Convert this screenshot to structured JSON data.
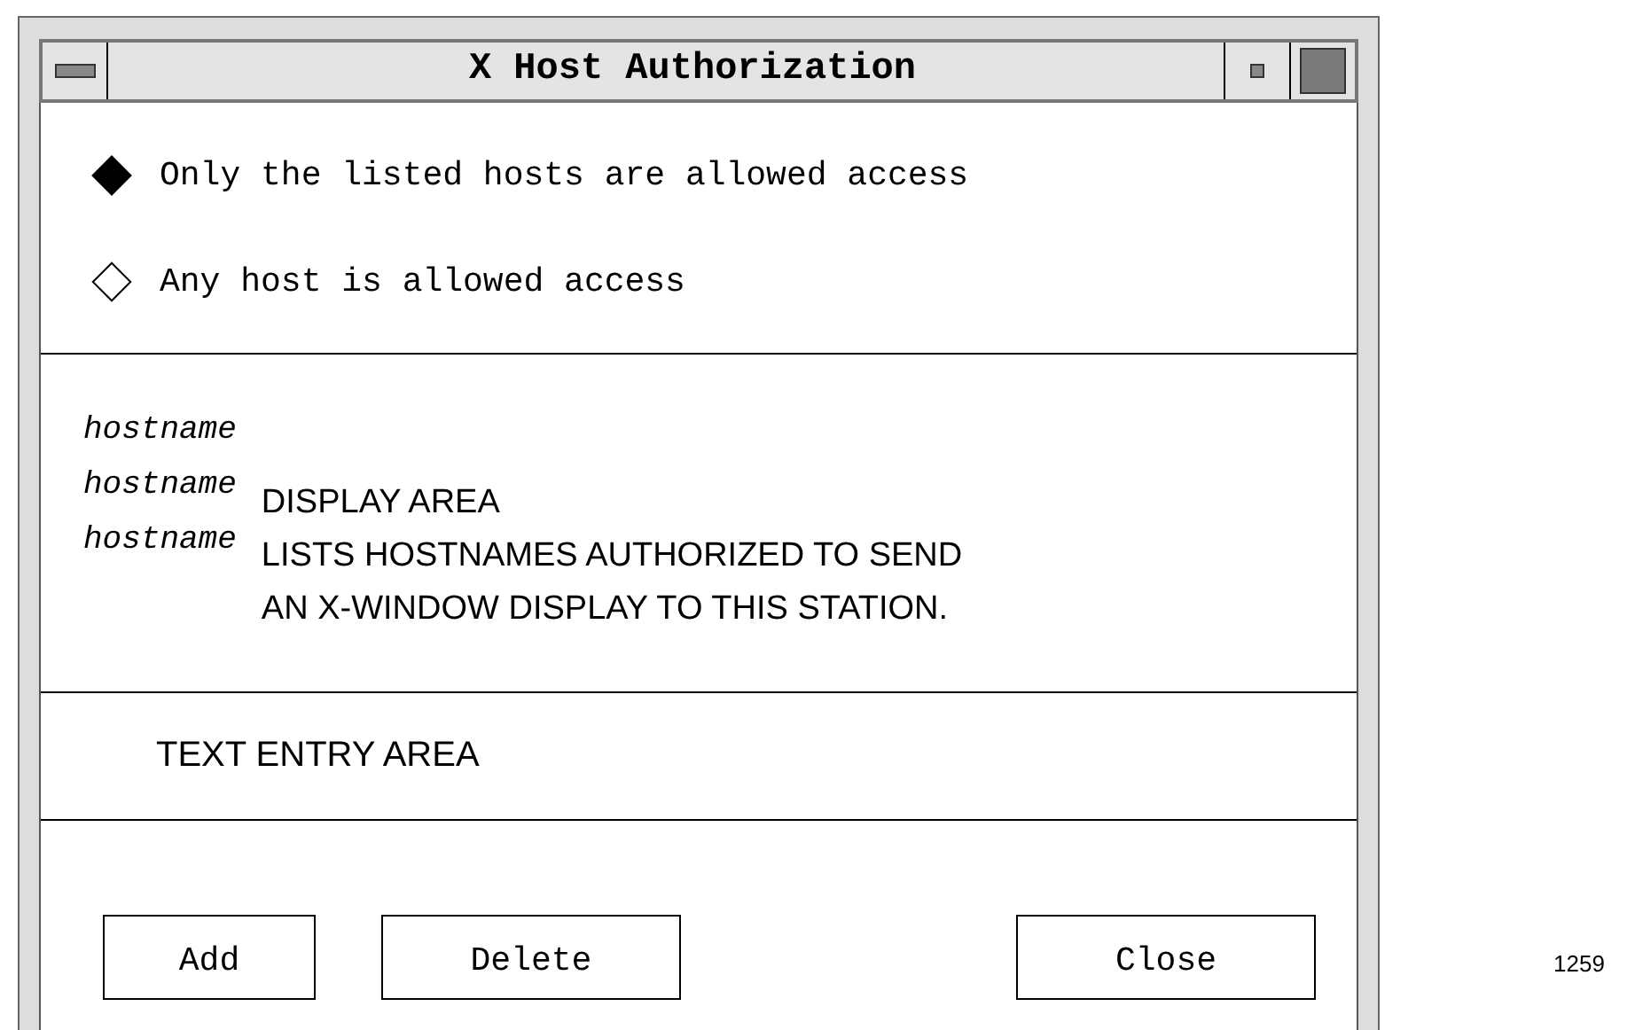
{
  "window": {
    "title": "X Host Authorization"
  },
  "access_options": [
    {
      "label": "Only the listed hosts are allowed access",
      "selected": true
    },
    {
      "label": "Any host is allowed access",
      "selected": false
    }
  ],
  "host_list": {
    "items": [
      "hostname",
      "hostname",
      "hostname"
    ],
    "caption": [
      "DISPLAY AREA",
      "LISTS HOSTNAMES AUTHORIZED TO SEND",
      "AN X-WINDOW DISPLAY TO THIS STATION."
    ]
  },
  "entry": {
    "placeholder": "TEXT ENTRY AREA"
  },
  "buttons": [
    "Add",
    "Delete",
    "Close"
  ],
  "figure_number": "1259"
}
